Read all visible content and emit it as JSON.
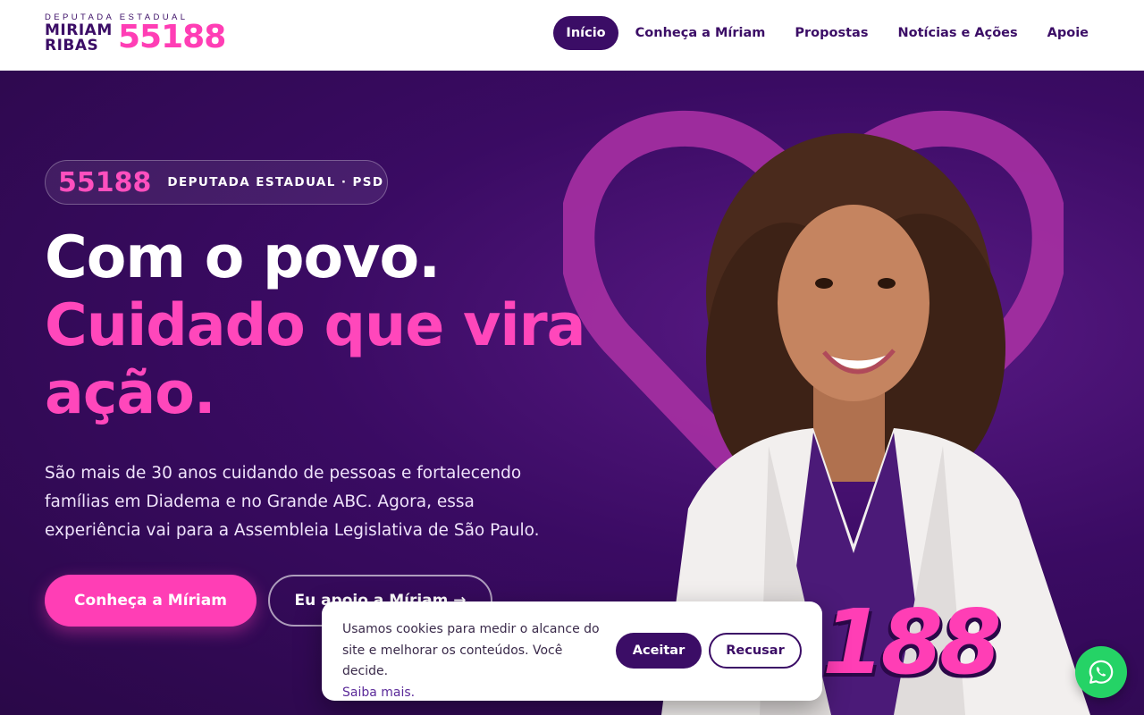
{
  "header": {
    "logo": {
      "kicker": "DEPUTADA ESTADUAL",
      "name_line1": "MIRIAM",
      "name_line2": "RIBAS",
      "number": "55188"
    },
    "nav": [
      {
        "label": "Início",
        "active": true
      },
      {
        "label": "Conheça a Míriam",
        "active": false
      },
      {
        "label": "Propostas",
        "active": false
      },
      {
        "label": "Notícias e Ações",
        "active": false
      },
      {
        "label": "Apoie",
        "active": false
      }
    ]
  },
  "hero": {
    "badge": {
      "number": "55188",
      "text": "DEPUTADA ESTADUAL · PSD"
    },
    "headline_line1": "Com o povo.",
    "headline_line2": "Cuidado que vira ação.",
    "lead": "São mais de 30 anos cuidando de pessoas e fortalecendo famílias em Diadema e no Grande ABC. Agora, essa experiência vai para a Assembleia Legislativa de São Paulo.",
    "primary_button": "Conheça a Míriam",
    "secondary_button": "Eu apoio a Míriam →",
    "big_number": "188"
  },
  "cookie": {
    "text": "Usamos cookies para medir o alcance do site e melhorar os conteúdos. Você decide.",
    "link": "Saiba mais.",
    "accept": "Aceitar",
    "reject": "Recusar"
  },
  "colors": {
    "brand_purple": "#3b0d66",
    "brand_pink": "#ff3eb5",
    "whatsapp_green": "#25d366"
  },
  "icons": [
    "heart-shape",
    "whatsapp-icon"
  ]
}
